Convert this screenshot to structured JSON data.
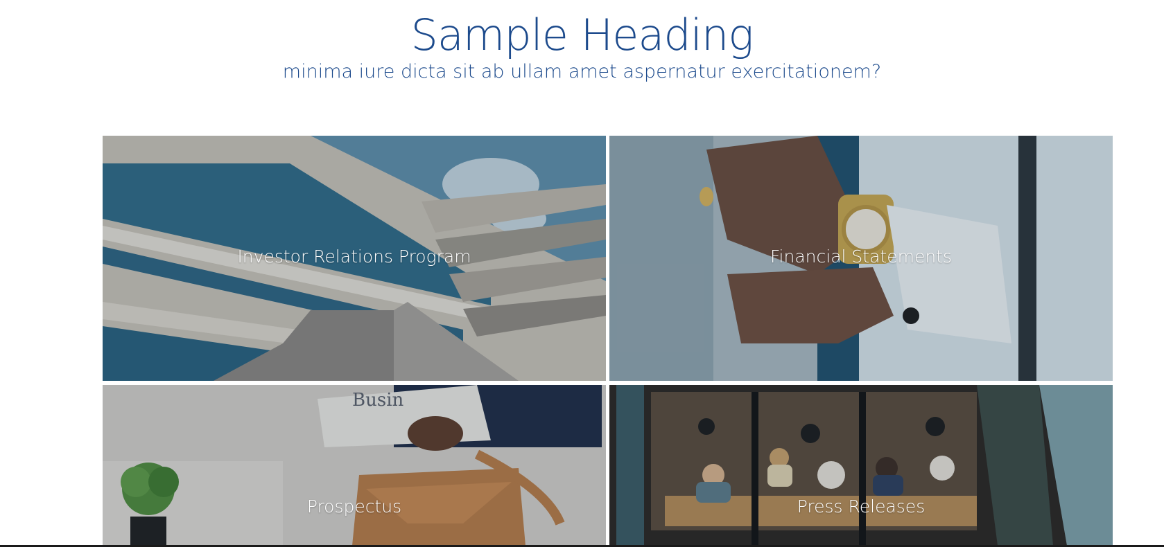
{
  "header": {
    "title": "Sample Heading",
    "subtitle": "minima iure dicta sit ab ullam amet aspernatur exercitationem?"
  },
  "tiles": [
    {
      "label": "Investor Relations Program",
      "image": "office-building-photo"
    },
    {
      "label": "Financial Statements",
      "image": "wristwatch-photo"
    },
    {
      "label": "Prospectus",
      "image": "briefcase-newspaper-photo"
    },
    {
      "label": "Press Releases",
      "image": "meeting-room-overhead-photo"
    }
  ],
  "colors": {
    "heading": "#1c4a8c",
    "label": "#ffffff"
  }
}
